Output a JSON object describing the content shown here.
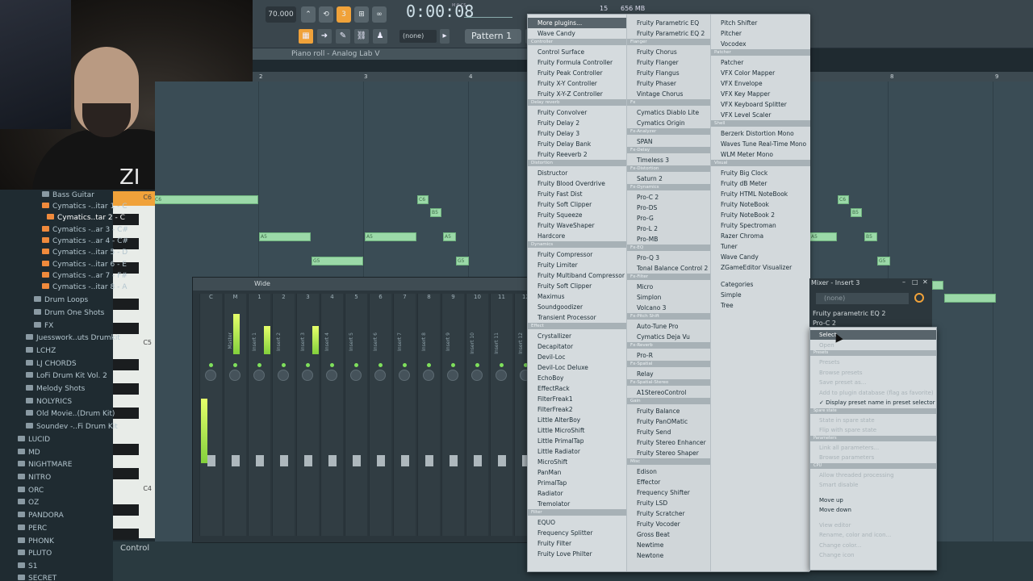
{
  "toolbar": {
    "tempo": "70.000",
    "timecode": "0:00:08",
    "timecode_label": "M:S:CS",
    "cpu_value": "15",
    "memory_value": "656 MB",
    "pattern_label": "Pattern 1",
    "none_selector": "(none)"
  },
  "piano_roll": {
    "title": "Piano roll - Analog Lab V",
    "ruler": [
      "2",
      "3",
      "4",
      "8",
      "9"
    ],
    "key_labels": [
      "C6",
      "C5",
      "C4"
    ],
    "control_label": "Control",
    "notes": [
      "C6",
      "B5",
      "A5",
      "A5",
      "B5",
      "G5",
      "G5",
      "C6",
      "B5",
      "A5",
      "B5",
      "G5"
    ]
  },
  "browser": {
    "items": [
      {
        "label": "Bass Guitar",
        "kind": "folder"
      },
      {
        "label": "Cymatics -..itar 1 - C",
        "kind": "pattern"
      },
      {
        "label": "Cymatics..tar 2 - C",
        "kind": "pattern"
      },
      {
        "label": "Cymatics -..ar 3 - C#",
        "kind": "pattern"
      },
      {
        "label": "Cymatics -..ar 4 - C#",
        "kind": "pattern"
      },
      {
        "label": "Cymatics -..itar 5 - D",
        "kind": "pattern"
      },
      {
        "label": "Cymatics -..itar 6 - E",
        "kind": "pattern"
      },
      {
        "label": "Cymatics -..ar 7 - F#",
        "kind": "pattern"
      },
      {
        "label": "Cymatics -..itar 8 - A",
        "kind": "pattern"
      },
      {
        "label": "Drum Loops",
        "kind": "folder"
      },
      {
        "label": "Drum One Shots",
        "kind": "folder"
      },
      {
        "label": "FX",
        "kind": "folder"
      },
      {
        "label": "Juesswork..uts Drumkit",
        "kind": "folder"
      },
      {
        "label": "LCHZ",
        "kind": "folder"
      },
      {
        "label": "LJ CHORDS",
        "kind": "folder"
      },
      {
        "label": "LoFi Drum Kit Vol. 2",
        "kind": "folder"
      },
      {
        "label": "Melody Shots",
        "kind": "folder"
      },
      {
        "label": "NOLYRICS",
        "kind": "folder"
      },
      {
        "label": "Old Movie..(Drum Kit)",
        "kind": "folder"
      },
      {
        "label": "Soundev -..Fi Drum Kit",
        "kind": "folder"
      },
      {
        "label": "LUCID",
        "kind": "folder"
      },
      {
        "label": "MD",
        "kind": "folder"
      },
      {
        "label": "NIGHTMARE",
        "kind": "folder"
      },
      {
        "label": "NITRO",
        "kind": "folder"
      },
      {
        "label": "ORC",
        "kind": "folder"
      },
      {
        "label": "OZ",
        "kind": "folder"
      },
      {
        "label": "PANDORA",
        "kind": "folder"
      },
      {
        "label": "PERC",
        "kind": "folder"
      },
      {
        "label": "PHONK",
        "kind": "folder"
      },
      {
        "label": "PLUTO",
        "kind": "folder"
      },
      {
        "label": "S1",
        "kind": "folder"
      },
      {
        "label": "SECRET",
        "kind": "folder"
      }
    ]
  },
  "mixer": {
    "title": "Wide",
    "strips": [
      {
        "num": "C",
        "label": ""
      },
      {
        "num": "M",
        "label": "Master"
      },
      {
        "num": "1",
        "label": "Insert 1"
      },
      {
        "num": "2",
        "label": "Insert 2"
      },
      {
        "num": "3",
        "label": "Insert 3"
      },
      {
        "num": "4",
        "label": "Insert 4"
      },
      {
        "num": "5",
        "label": "Insert 5"
      },
      {
        "num": "6",
        "label": "Insert 6"
      },
      {
        "num": "7",
        "label": "Insert 7"
      },
      {
        "num": "8",
        "label": "Insert 8"
      },
      {
        "num": "9",
        "label": "Insert 9"
      },
      {
        "num": "10",
        "label": "Insert 10"
      },
      {
        "num": "11",
        "label": "Insert 11"
      },
      {
        "num": "12",
        "label": "Insert 12"
      }
    ]
  },
  "fx_menu": {
    "col1": [
      {
        "t": "item",
        "label": "More plugins...",
        "style": "top"
      },
      {
        "t": "item",
        "label": "Wave Candy"
      },
      {
        "t": "head",
        "label": "Controller"
      },
      {
        "t": "item",
        "label": "Control Surface"
      },
      {
        "t": "item",
        "label": "Fruity Formula Controller"
      },
      {
        "t": "item",
        "label": "Fruity Peak Controller"
      },
      {
        "t": "item",
        "label": "Fruity X-Y Controller"
      },
      {
        "t": "item",
        "label": "Fruity X-Y-Z Controller"
      },
      {
        "t": "head",
        "label": "Delay reverb"
      },
      {
        "t": "item",
        "label": "Fruity Convolver"
      },
      {
        "t": "item",
        "label": "Fruity Delay 2"
      },
      {
        "t": "item",
        "label": "Fruity Delay 3"
      },
      {
        "t": "item",
        "label": "Fruity Delay Bank"
      },
      {
        "t": "item",
        "label": "Fruity Reeverb 2"
      },
      {
        "t": "head",
        "label": "Distortion"
      },
      {
        "t": "item",
        "label": "Distructor"
      },
      {
        "t": "item",
        "label": "Fruity Blood Overdrive"
      },
      {
        "t": "item",
        "label": "Fruity Fast Dist"
      },
      {
        "t": "item",
        "label": "Fruity Soft Clipper"
      },
      {
        "t": "item",
        "label": "Fruity Squeeze"
      },
      {
        "t": "item",
        "label": "Fruity WaveShaper"
      },
      {
        "t": "item",
        "label": "Hardcore"
      },
      {
        "t": "head",
        "label": "Dynamics"
      },
      {
        "t": "item",
        "label": "Fruity Compressor"
      },
      {
        "t": "item",
        "label": "Fruity Limiter"
      },
      {
        "t": "item",
        "label": "Fruity Multiband Compressor"
      },
      {
        "t": "item",
        "label": "Fruity Soft Clipper"
      },
      {
        "t": "item",
        "label": "Maximus"
      },
      {
        "t": "item",
        "label": "Soundgoodizer"
      },
      {
        "t": "item",
        "label": "Transient Processor"
      },
      {
        "t": "head",
        "label": "Effect"
      },
      {
        "t": "item",
        "label": "Crystallizer"
      },
      {
        "t": "item",
        "label": "Decapitator"
      },
      {
        "t": "item",
        "label": "Devil-Loc"
      },
      {
        "t": "item",
        "label": "Devil-Loc Deluxe"
      },
      {
        "t": "item",
        "label": "EchoBoy"
      },
      {
        "t": "item",
        "label": "EffectRack"
      },
      {
        "t": "item",
        "label": "FilterFreak1"
      },
      {
        "t": "item",
        "label": "FilterFreak2"
      },
      {
        "t": "item",
        "label": "Little AlterBoy"
      },
      {
        "t": "item",
        "label": "Little MicroShift"
      },
      {
        "t": "item",
        "label": "Little PrimalTap"
      },
      {
        "t": "item",
        "label": "Little Radiator"
      },
      {
        "t": "item",
        "label": "MicroShift"
      },
      {
        "t": "item",
        "label": "PanMan"
      },
      {
        "t": "item",
        "label": "PrimalTap"
      },
      {
        "t": "item",
        "label": "Radiator"
      },
      {
        "t": "item",
        "label": "Tremolator"
      },
      {
        "t": "head",
        "label": "Filter"
      },
      {
        "t": "item",
        "label": "EQUO"
      },
      {
        "t": "item",
        "label": "Frequency Splitter"
      },
      {
        "t": "item",
        "label": "Fruity Filter"
      },
      {
        "t": "item",
        "label": "Fruity Love Philter"
      }
    ],
    "col2": [
      {
        "t": "item",
        "label": "Fruity Parametric EQ"
      },
      {
        "t": "item",
        "label": "Fruity Parametric EQ 2"
      },
      {
        "t": "head",
        "label": "Flanger"
      },
      {
        "t": "item",
        "label": "Fruity Chorus"
      },
      {
        "t": "item",
        "label": "Fruity Flanger"
      },
      {
        "t": "item",
        "label": "Fruity Flangus"
      },
      {
        "t": "item",
        "label": "Fruity Phaser"
      },
      {
        "t": "item",
        "label": "Vintage Chorus"
      },
      {
        "t": "head",
        "label": "Fx"
      },
      {
        "t": "item",
        "label": "Cymatics Diablo Lite"
      },
      {
        "t": "item",
        "label": "Cymatics Origin"
      },
      {
        "t": "head",
        "label": "Fx-Analyzer"
      },
      {
        "t": "item",
        "label": "SPAN"
      },
      {
        "t": "head",
        "label": "Fx-Delay"
      },
      {
        "t": "item",
        "label": "Timeless 3"
      },
      {
        "t": "head",
        "label": "Fx-Distortion"
      },
      {
        "t": "item",
        "label": "Saturn 2"
      },
      {
        "t": "head",
        "label": "Fx-Dynamics"
      },
      {
        "t": "item",
        "label": "Pro-C 2"
      },
      {
        "t": "item",
        "label": "Pro-DS"
      },
      {
        "t": "item",
        "label": "Pro-G"
      },
      {
        "t": "item",
        "label": "Pro-L 2"
      },
      {
        "t": "item",
        "label": "Pro-MB"
      },
      {
        "t": "head",
        "label": "Fx-EQ"
      },
      {
        "t": "item",
        "label": "Pro-Q 3"
      },
      {
        "t": "item",
        "label": "Tonal Balance Control 2"
      },
      {
        "t": "head",
        "label": "Fx-Filter"
      },
      {
        "t": "item",
        "label": "Micro"
      },
      {
        "t": "item",
        "label": "Simplon"
      },
      {
        "t": "item",
        "label": "Volcano 3"
      },
      {
        "t": "head",
        "label": "Fx-Pitch Shift"
      },
      {
        "t": "item",
        "label": "Auto-Tune Pro"
      },
      {
        "t": "item",
        "label": "Cymatics Deja Vu"
      },
      {
        "t": "head",
        "label": "Fx-Reverb"
      },
      {
        "t": "item",
        "label": "Pro-R"
      },
      {
        "t": "head",
        "label": "Fx-Spatial"
      },
      {
        "t": "item",
        "label": "Relay"
      },
      {
        "t": "head",
        "label": "Fx-Spatial-Stereo"
      },
      {
        "t": "item",
        "label": "A1StereoControl"
      },
      {
        "t": "head",
        "label": "Gain"
      },
      {
        "t": "item",
        "label": "Fruity Balance"
      },
      {
        "t": "item",
        "label": "Fruity PanOMatic"
      },
      {
        "t": "item",
        "label": "Fruity Send"
      },
      {
        "t": "item",
        "label": "Fruity Stereo Enhancer"
      },
      {
        "t": "item",
        "label": "Fruity Stereo Shaper"
      },
      {
        "t": "head",
        "label": "Misc"
      },
      {
        "t": "item",
        "label": "Edison"
      },
      {
        "t": "item",
        "label": "Effector"
      },
      {
        "t": "item",
        "label": "Frequency Shifter"
      },
      {
        "t": "item",
        "label": "Fruity LSD"
      },
      {
        "t": "item",
        "label": "Fruity Scratcher"
      },
      {
        "t": "item",
        "label": "Fruity Vocoder"
      },
      {
        "t": "item",
        "label": "Gross Beat"
      },
      {
        "t": "item",
        "label": "Newtime"
      },
      {
        "t": "item",
        "label": "Newtone"
      }
    ],
    "col3": [
      {
        "t": "item",
        "label": "Pitch Shifter"
      },
      {
        "t": "item",
        "label": "Pitcher"
      },
      {
        "t": "item",
        "label": "Vocodex"
      },
      {
        "t": "head",
        "label": "Patcher"
      },
      {
        "t": "item",
        "label": "Patcher"
      },
      {
        "t": "item",
        "label": "VFX Color Mapper"
      },
      {
        "t": "item",
        "label": "VFX Envelope"
      },
      {
        "t": "item",
        "label": "VFX Key Mapper"
      },
      {
        "t": "item",
        "label": "VFX Keyboard Splitter"
      },
      {
        "t": "item",
        "label": "VFX Level Scaler"
      },
      {
        "t": "head",
        "label": "Shell"
      },
      {
        "t": "item",
        "label": "Berzerk Distortion Mono"
      },
      {
        "t": "item",
        "label": "Waves Tune Real-Time Mono"
      },
      {
        "t": "item",
        "label": "WLM Meter Mono"
      },
      {
        "t": "head",
        "label": "Visual"
      },
      {
        "t": "item",
        "label": "Fruity Big Clock"
      },
      {
        "t": "item",
        "label": "Fruity dB Meter"
      },
      {
        "t": "item",
        "label": "Fruity HTML NoteBook"
      },
      {
        "t": "item",
        "label": "Fruity NoteBook"
      },
      {
        "t": "item",
        "label": "Fruity NoteBook 2"
      },
      {
        "t": "item",
        "label": "Fruity Spectroman"
      },
      {
        "t": "item",
        "label": "Razer Chroma"
      },
      {
        "t": "item",
        "label": "Tuner"
      },
      {
        "t": "item",
        "label": "Wave Candy"
      },
      {
        "t": "item",
        "label": "ZGameEditor Visualizer"
      },
      {
        "t": "gap",
        "label": ""
      },
      {
        "t": "item",
        "label": "Categories",
        "bullet": "●"
      },
      {
        "t": "item",
        "label": "Simple"
      },
      {
        "t": "item",
        "label": "Tree"
      }
    ]
  },
  "insert_panel": {
    "title": "Mixer - Insert 3",
    "preset": "(none)",
    "slots": [
      "Fruity parametric EQ 2",
      "Pro-C 2"
    ]
  },
  "context_menu": [
    {
      "t": "item",
      "label": "Select",
      "style": "hl"
    },
    {
      "t": "item",
      "label": "Open",
      "style": "dis"
    },
    {
      "t": "head",
      "label": "Presets"
    },
    {
      "t": "item",
      "label": "Presets",
      "style": "dis"
    },
    {
      "t": "item",
      "label": "Browse presets",
      "style": "dis"
    },
    {
      "t": "item",
      "label": "Save preset as...",
      "style": "dis"
    },
    {
      "t": "item",
      "label": "Add to plugin database (flag as favorite)",
      "style": "dis"
    },
    {
      "t": "item",
      "label": "✓ Display preset name in preset selector"
    },
    {
      "t": "head",
      "label": "Spare state"
    },
    {
      "t": "item",
      "label": "State in spare state",
      "style": "dis"
    },
    {
      "t": "item",
      "label": "Flip with spare state",
      "style": "dis"
    },
    {
      "t": "head",
      "label": "Parameters"
    },
    {
      "t": "item",
      "label": "Link all parameters...",
      "style": "dis"
    },
    {
      "t": "item",
      "label": "Browse parameters",
      "style": "dis"
    },
    {
      "t": "head",
      "label": "CPU"
    },
    {
      "t": "item",
      "label": "Allow threaded processing",
      "style": "dis"
    },
    {
      "t": "item",
      "label": "Smart disable",
      "style": "dis"
    },
    {
      "t": "gap",
      "label": ""
    },
    {
      "t": "item",
      "label": "Move up"
    },
    {
      "t": "item",
      "label": "Move down"
    },
    {
      "t": "gap",
      "label": ""
    },
    {
      "t": "item",
      "label": "View editor",
      "style": "dis"
    },
    {
      "t": "item",
      "label": "Rename, color and icon...",
      "style": "dis"
    },
    {
      "t": "item",
      "label": "Change color...",
      "style": "dis"
    },
    {
      "t": "item",
      "label": "Change icon",
      "style": "dis"
    }
  ],
  "colors": {
    "accent_green": "#9bd9a8",
    "meter_green": "#82d03c",
    "pattern_orange": "#f08a3c"
  }
}
